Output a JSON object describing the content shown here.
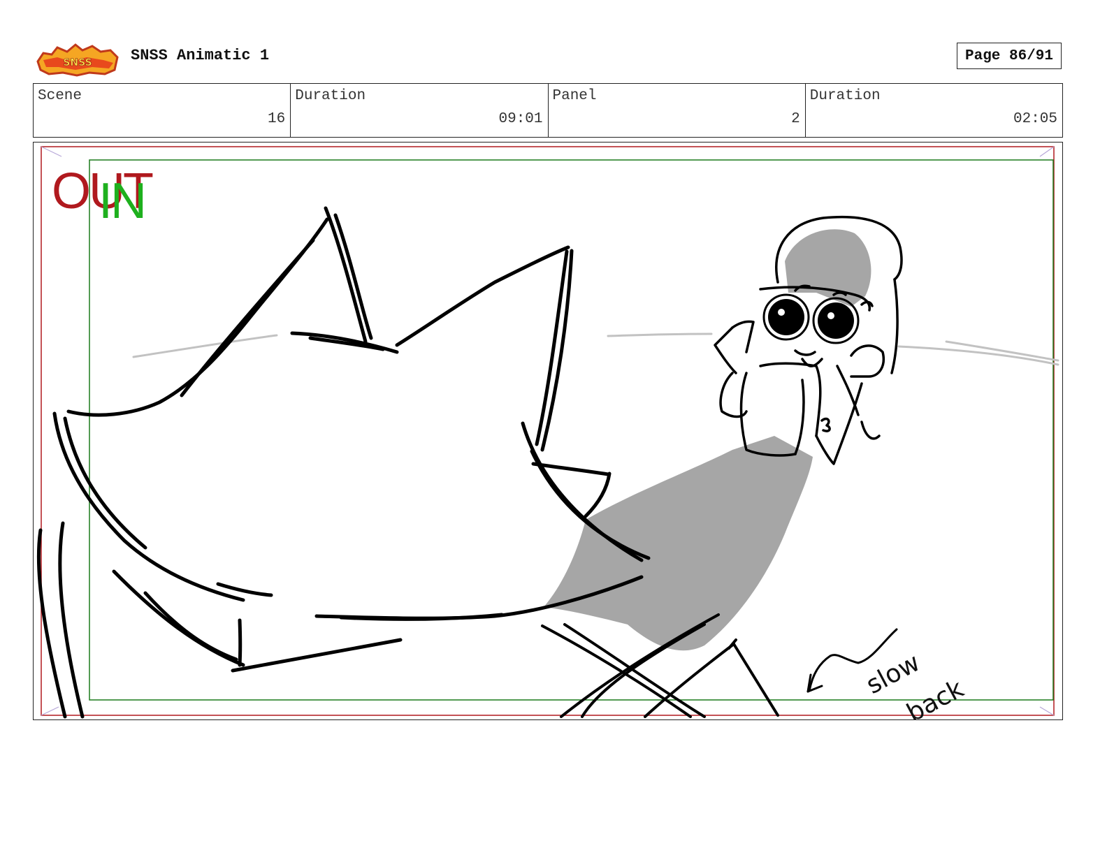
{
  "header": {
    "logo_text": "SNSS",
    "title": "SNSS Animatic 1",
    "page": "Page 86/91"
  },
  "info": [
    {
      "label": "Scene",
      "value": "16"
    },
    {
      "label": "Duration",
      "value": "09:01"
    },
    {
      "label": "Panel",
      "value": "2"
    },
    {
      "label": "Duration",
      "value": "02:05"
    }
  ],
  "panel": {
    "out_label": "OUT",
    "in_label": "IN",
    "note_line1": "slow",
    "note_line2": "back",
    "colors": {
      "out_frame": "#b0191e",
      "in_frame": "#1b7a1b",
      "shadow": "#a6a6a6"
    }
  }
}
